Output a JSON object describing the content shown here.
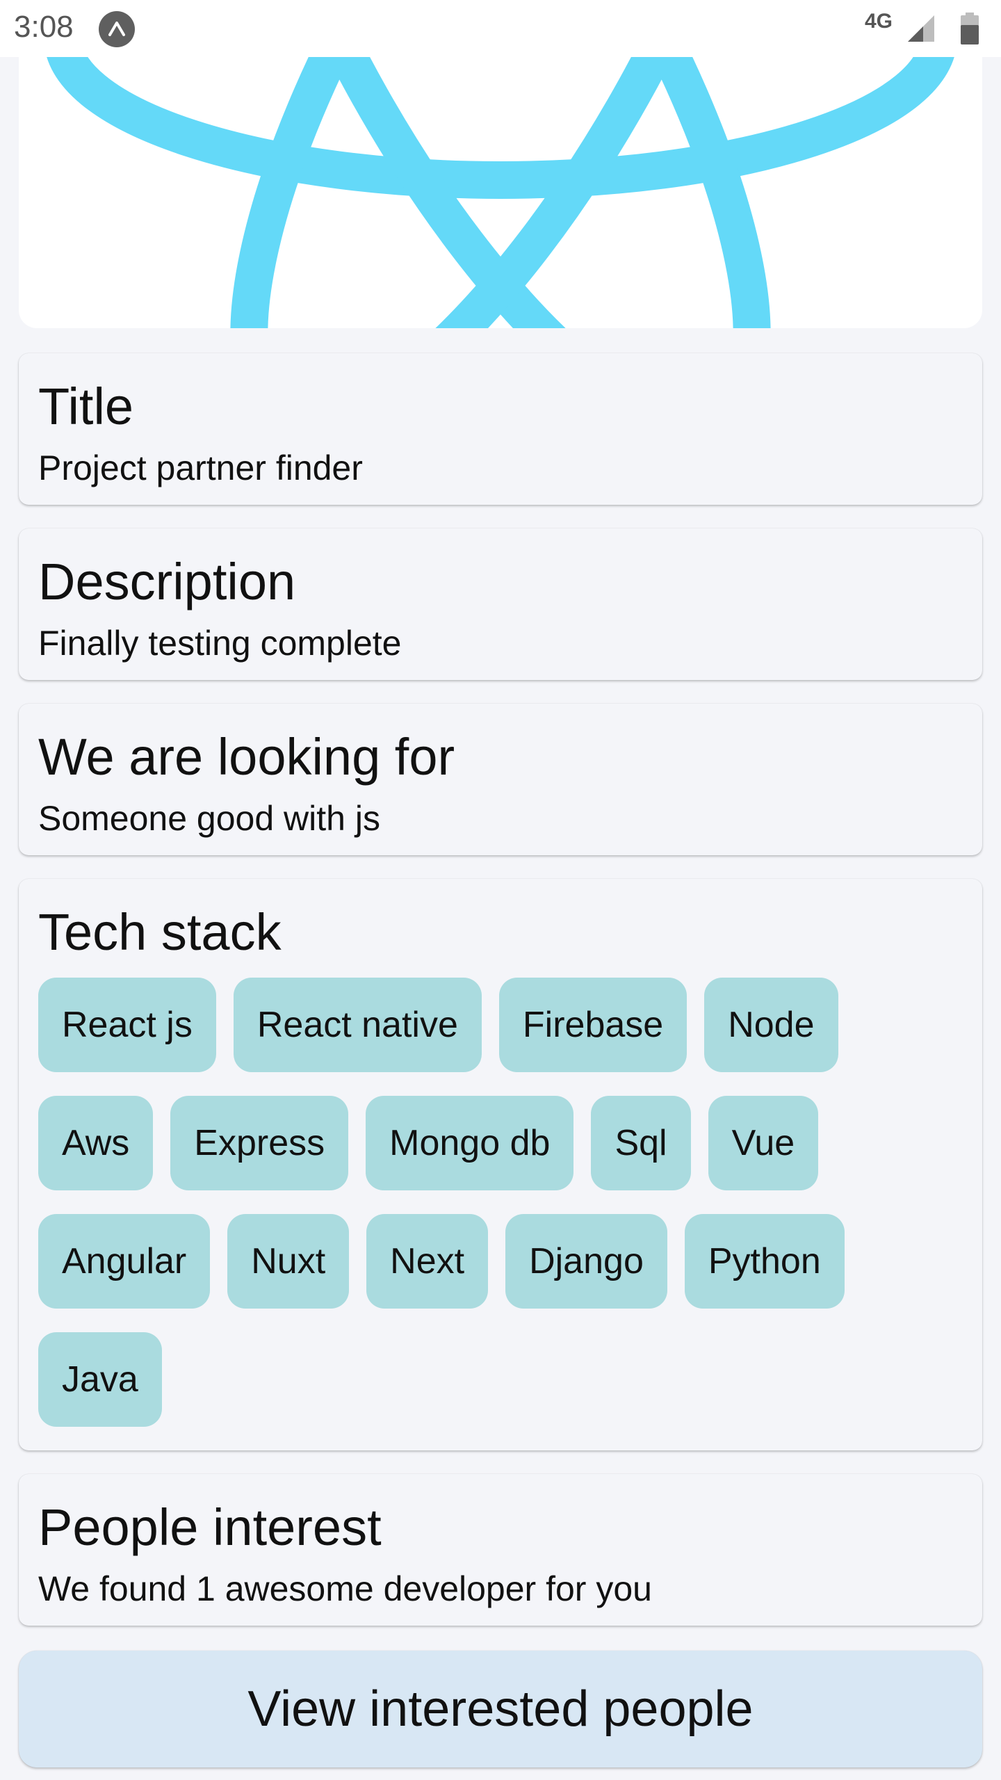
{
  "status_bar": {
    "time": "3:08",
    "network": "4G",
    "app_icon": "expo-icon",
    "signal_icon": "signal-icon",
    "battery_icon": "battery-icon"
  },
  "hero_image": {
    "icon": "react-logo-icon",
    "color": "#64d9f8"
  },
  "cards": {
    "title": {
      "heading": "Title",
      "value": "Project partner finder"
    },
    "description": {
      "heading": "Description",
      "value": "Finally testing complete"
    },
    "looking_for": {
      "heading": "We are looking for",
      "value": "Someone good with js"
    },
    "tech_stack": {
      "heading": "Tech stack",
      "chips": [
        "React js",
        "React native",
        "Firebase",
        "Node",
        "Aws",
        "Express",
        "Mongo db",
        "Sql",
        "Vue",
        "Angular",
        "Nuxt",
        "Next",
        "Django",
        "Python",
        "Java"
      ]
    },
    "people_interest": {
      "heading": "People interest",
      "value": "We found 1 awesome developer for you"
    }
  },
  "actions": {
    "view_interested_label": "View interested people"
  },
  "colors": {
    "background": "#f4f5f9",
    "chip": "#aadbdf",
    "button": "#d8e7f4",
    "accent": "#64d9f8"
  }
}
